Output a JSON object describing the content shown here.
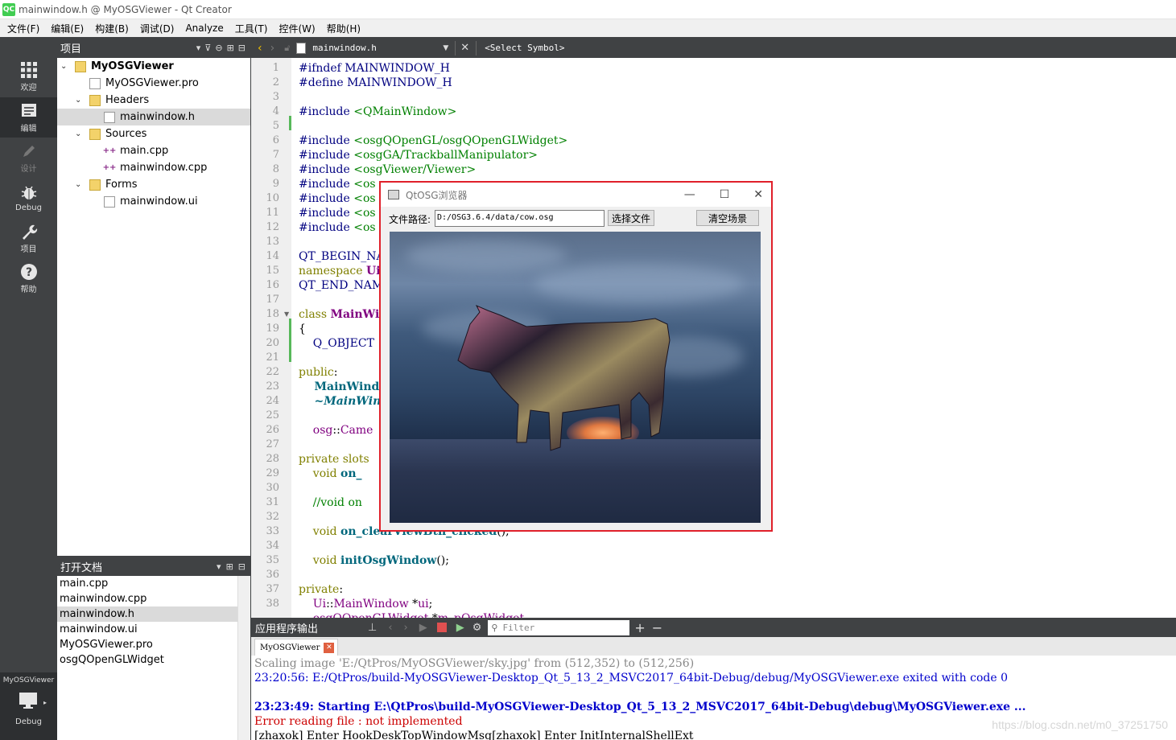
{
  "window": {
    "title": "mainwindow.h @ MyOSGViewer - Qt Creator",
    "logo": "QC"
  },
  "menu": [
    "文件(F)",
    "编辑(E)",
    "构建(B)",
    "调试(D)",
    "Analyze",
    "工具(T)",
    "控件(W)",
    "帮助(H)"
  ],
  "modes": {
    "welcome": "欢迎",
    "edit": "编辑",
    "design": "设计",
    "debug": "Debug",
    "projects": "项目",
    "help": "帮助",
    "kit_name": "MyOSGViewer",
    "kit_mode": "Debug"
  },
  "project_panel": {
    "title": "项目",
    "tree": {
      "root": "MyOSGViewer",
      "pro": "MyOSGViewer.pro",
      "headers": "Headers",
      "header_file": "mainwindow.h",
      "sources": "Sources",
      "source1": "main.cpp",
      "source2": "mainwindow.cpp",
      "forms": "Forms",
      "form1": "mainwindow.ui"
    }
  },
  "open_docs": {
    "title": "打开文档",
    "items": [
      "main.cpp",
      "mainwindow.cpp",
      "mainwindow.h",
      "mainwindow.ui",
      "MyOSGViewer.pro",
      "osgQOpenGLWidget"
    ]
  },
  "editor": {
    "filename": "mainwindow.h",
    "symbol": "<Select Symbol>",
    "line_numbers": [
      "1",
      "2",
      "3",
      "4",
      "5",
      "6",
      "7",
      "8",
      "9",
      "10",
      "11",
      "12",
      "13",
      "14",
      "15",
      "16",
      "17",
      "18",
      "19",
      "20",
      "21",
      "22",
      "23",
      "24",
      "25",
      "26",
      "27",
      "28",
      "29",
      "30",
      "31",
      "32",
      "33",
      "34",
      "35",
      "36",
      "37",
      "38"
    ]
  },
  "dialog": {
    "title": "QtOSG浏览器",
    "path_label": "文件路径:",
    "path_value": "D:/OSG3.6.4/data/cow.osg",
    "select_button": "选择文件",
    "clear_button": "清空场景"
  },
  "output": {
    "title": "应用程序输出",
    "filter_placeholder": "Filter",
    "tab": "MyOSGViewer",
    "lines": {
      "l1": "Scaling image 'E:/QtPros/MyOSGViewer/sky.jpg' from (512,352) to (512,256)",
      "l2": "23:20:56: E:/QtPros/build-MyOSGViewer-Desktop_Qt_5_13_2_MSVC2017_64bit-Debug/debug/MyOSGViewer.exe exited with code 0",
      "l3": "23:23:49: Starting E:\\QtPros\\build-MyOSGViewer-Desktop_Qt_5_13_2_MSVC2017_64bit-Debug\\debug\\MyOSGViewer.exe ...",
      "l4": "Error reading file : not implemented",
      "l5": "[zhaxok] Enter HookDeskTopWindowMsg[zhaxok] Enter InitInternalShellExt"
    },
    "watermark": "https://blog.csdn.net/m0_37251750"
  },
  "colors": {
    "accent_red": "#e0202a",
    "qt_green": "#41cd52",
    "output_blue": "#0000cc",
    "error_red": "#cc0000"
  }
}
